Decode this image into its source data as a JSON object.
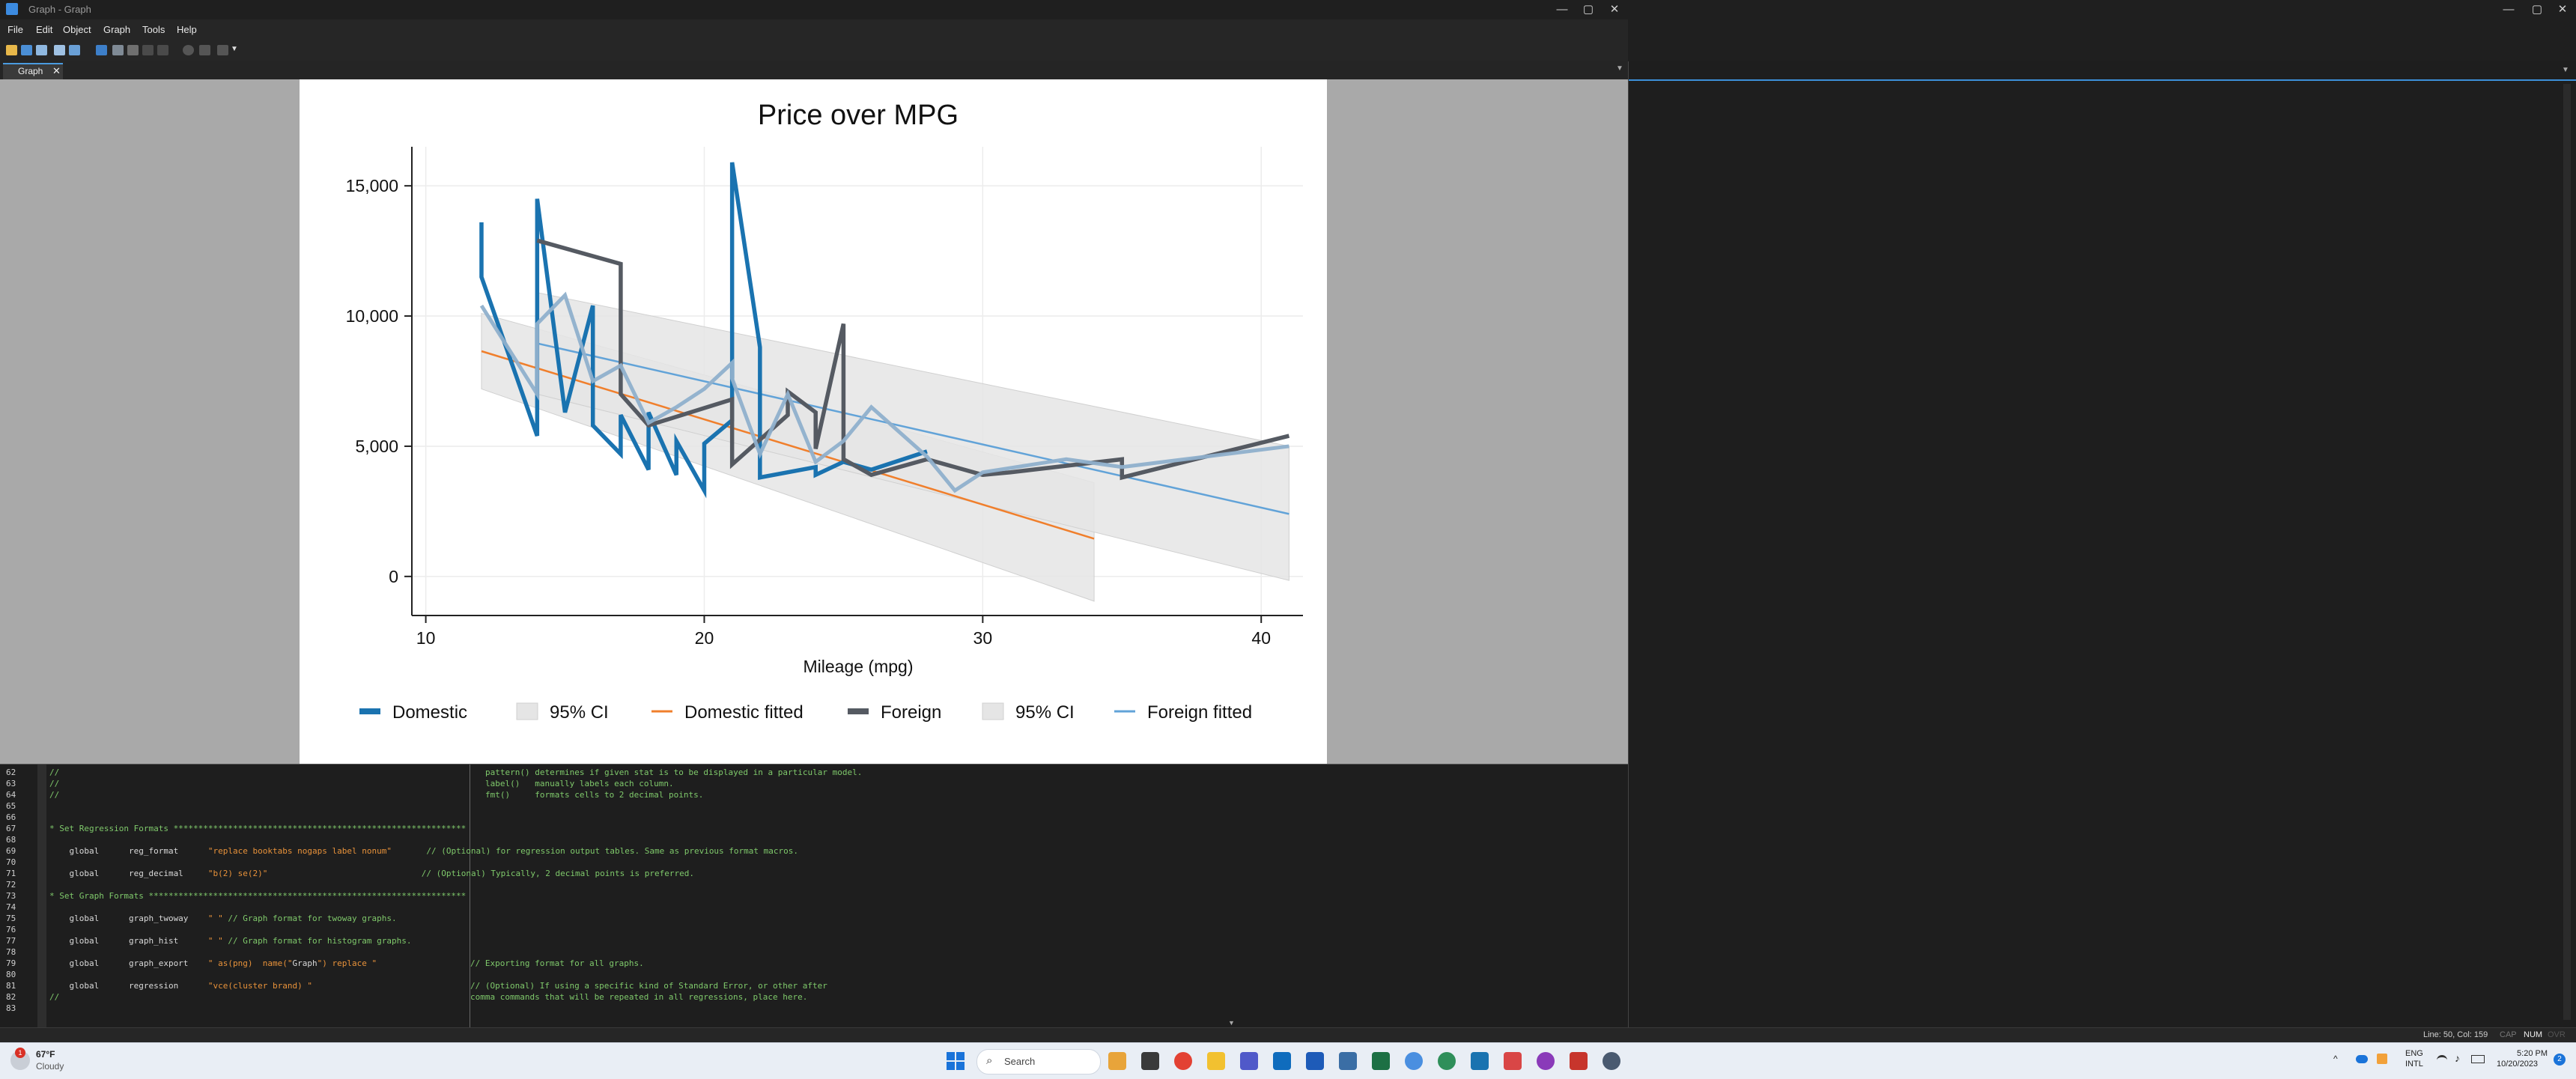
{
  "window": {
    "title": "Graph - Graph",
    "controls": {
      "minimize": "—",
      "maximize": "▢",
      "close": "✕"
    }
  },
  "menu": [
    "File",
    "Edit",
    "Object",
    "Graph",
    "Tools",
    "Help"
  ],
  "toolbar": {
    "icons": [
      "open-icon",
      "save-icon",
      "print-icon",
      "copy-icon",
      "rename-icon",
      "graph-editor-icon",
      "table-icon",
      "brush-icon",
      "undo-icon",
      "redo-icon",
      "record-icon",
      "pause-icon",
      "play-icon"
    ]
  },
  "tabs": {
    "active": "Graph",
    "close": "✕"
  },
  "colors": {
    "domestic": "#1a73b0",
    "foreign": "#555a62",
    "domestic_fit": "#f07f2c",
    "foreign_fit": "#62a3d8",
    "ci": "#e5e5e5"
  },
  "chart_data": {
    "type": "line",
    "title": "Price over MPG",
    "xlabel": "Mileage (mpg)",
    "ylabel": "",
    "xlim": [
      9.5,
      41.5
    ],
    "ylim": [
      -1500,
      16500
    ],
    "xticks": [
      10,
      20,
      30,
      40
    ],
    "yticks": [
      0,
      5000,
      10000,
      15000
    ],
    "ytick_labels": [
      "0",
      "5,000",
      "10,000",
      "15,000"
    ],
    "grid": true,
    "legend_position": "bottom",
    "legend": [
      "Domestic",
      "95% CI",
      "Domestic fitted",
      "Foreign",
      "95% CI",
      "Foreign fitted"
    ],
    "series": [
      {
        "name": "Domestic",
        "type": "line",
        "points": [
          [
            12,
            13600
          ],
          [
            12,
            11500
          ],
          [
            14,
            5400
          ],
          [
            14,
            14500
          ],
          [
            15,
            6300
          ],
          [
            16,
            10400
          ],
          [
            16,
            5800
          ],
          [
            17,
            4700
          ],
          [
            17,
            6200
          ],
          [
            18,
            4100
          ],
          [
            18,
            6300
          ],
          [
            19,
            3900
          ],
          [
            19,
            5200
          ],
          [
            20,
            3300
          ],
          [
            20,
            5100
          ],
          [
            21,
            6000
          ],
          [
            21,
            15900
          ],
          [
            22,
            8800
          ],
          [
            22,
            3800
          ],
          [
            24,
            4200
          ],
          [
            24,
            3900
          ],
          [
            25,
            4400
          ],
          [
            26,
            4100
          ],
          [
            28,
            4800
          ]
        ]
      },
      {
        "name": "Foreign",
        "type": "line",
        "points": [
          [
            14,
            12900
          ],
          [
            17,
            12000
          ],
          [
            17,
            7000
          ],
          [
            18,
            5800
          ],
          [
            21,
            6800
          ],
          [
            21,
            4300
          ],
          [
            23,
            6200
          ],
          [
            23,
            7100
          ],
          [
            24,
            6300
          ],
          [
            24,
            4900
          ],
          [
            25,
            9700
          ],
          [
            25,
            4500
          ],
          [
            26,
            3900
          ],
          [
            28,
            4500
          ],
          [
            30,
            3900
          ],
          [
            31,
            4000
          ],
          [
            35,
            4500
          ],
          [
            35,
            3800
          ],
          [
            41,
            5400
          ]
        ]
      },
      {
        "name": "Domestic",
        "type": "line",
        "role": "light",
        "points": [
          [
            12,
            10400
          ],
          [
            14,
            7000
          ],
          [
            14,
            9700
          ],
          [
            15,
            10800
          ],
          [
            16,
            7500
          ],
          [
            17,
            8100
          ],
          [
            18,
            5900
          ],
          [
            19,
            6500
          ],
          [
            20,
            7200
          ],
          [
            21,
            8200
          ],
          [
            21,
            7600
          ],
          [
            22,
            4700
          ],
          [
            23,
            7000
          ],
          [
            24,
            4400
          ],
          [
            25,
            5200
          ],
          [
            26,
            6500
          ],
          [
            28,
            4600
          ],
          [
            29,
            3300
          ],
          [
            30,
            4000
          ],
          [
            33,
            4500
          ],
          [
            35,
            4200
          ],
          [
            41,
            5000
          ]
        ]
      },
      {
        "name": "Domestic fitted",
        "type": "fit",
        "x": [
          12,
          34
        ],
        "y": [
          8650,
          1450
        ]
      },
      {
        "name": "Foreign fitted",
        "type": "fit",
        "x": [
          14,
          41
        ],
        "y": [
          8950,
          2400
        ]
      },
      {
        "name": "95% CI",
        "type": "band",
        "x": [
          12,
          34
        ],
        "upper": [
          10100,
          3600
        ],
        "lower": [
          7200,
          -950
        ]
      },
      {
        "name": "95% CI",
        "type": "band",
        "x": [
          14,
          41
        ],
        "upper": [
          10900,
          5000
        ],
        "lower": [
          7000,
          -150
        ]
      }
    ]
  },
  "editor": {
    "lines": [
      {
        "n": "62",
        "left": "//",
        "right": "pattern() determines if given stat is to be displayed in a particular model."
      },
      {
        "n": "63",
        "left": "//",
        "right": "label()   manually labels each column."
      },
      {
        "n": "64",
        "left": "//",
        "right": "fmt()     formats cells to 2 decimal points."
      },
      {
        "n": "65",
        "left": "",
        "right": ""
      },
      {
        "n": "66",
        "left": "",
        "right": ""
      },
      {
        "n": "67",
        "left": "* Set Regression Formats ***********************************************************",
        "right": ""
      },
      {
        "n": "68",
        "left": "",
        "right": ""
      },
      {
        "n": "69",
        "left": "    global      reg_format      \"replace booktabs nogaps label nonum\"       // (Optional) for regression output tables. Same as previous format macros.",
        "right": ""
      },
      {
        "n": "70",
        "left": "",
        "right": ""
      },
      {
        "n": "71",
        "left": "    global      reg_decimal     \"b(2) se(2)\"                               // (Optional) Typically, 2 decimal points is preferred.",
        "right": ""
      },
      {
        "n": "72",
        "left": "",
        "right": ""
      },
      {
        "n": "73",
        "left": "* Set Graph Formats ****************************************************************",
        "right": ""
      },
      {
        "n": "74",
        "left": "",
        "right": ""
      },
      {
        "n": "75",
        "left": "    global      graph_twoway    \" \" // Graph format for twoway graphs.",
        "right": ""
      },
      {
        "n": "76",
        "left": "",
        "right": ""
      },
      {
        "n": "77",
        "left": "    global      graph_hist      \" \" // Graph format for histogram graphs.",
        "right": ""
      },
      {
        "n": "78",
        "left": "",
        "right": ""
      },
      {
        "n": "79",
        "left": "    global      graph_export    \" as(png)  name(\"Graph\") replace \"",
        "right": "// Exporting format for all graphs."
      },
      {
        "n": "80",
        "left": "",
        "right": ""
      },
      {
        "n": "81",
        "left": "    global      regression      \"vce(cluster brand) \"",
        "right": "// (Optional) If using a specific kind of Standard Error, or other after"
      },
      {
        "n": "82",
        "left": "//",
        "right": "comma commands that will be repeated in all regressions, place here."
      },
      {
        "n": "83",
        "left": "",
        "right": ""
      }
    ]
  },
  "status": {
    "position": "Line: 50, Col: 159",
    "caps": "CAP",
    "num": "NUM",
    "ovr": "OVR"
  },
  "taskbar": {
    "weather_temp": "67°F",
    "weather_desc": "Cloudy",
    "weather_badge": "1",
    "search_placeholder": "Search",
    "lang1": "ENG",
    "lang2": "INTL",
    "time": "5:20 PM",
    "date": "10/20/2023",
    "notif": "2"
  }
}
